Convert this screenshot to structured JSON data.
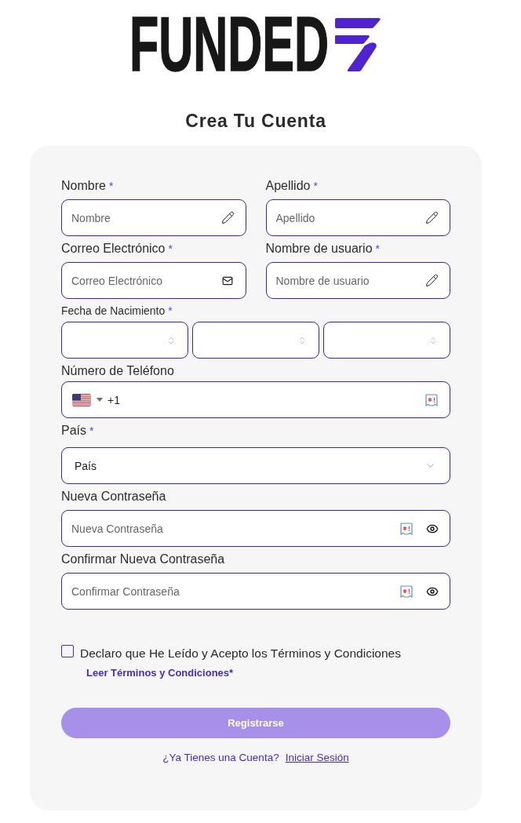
{
  "logo": {
    "wordmark": "FUNDED"
  },
  "title": "Crea Tu Cuenta",
  "form": {
    "rows": [
      {
        "fields": [
          {
            "kind": "text",
            "label": "Nombre",
            "required_mark": "*",
            "placeholder": "Nombre"
          },
          {
            "kind": "text",
            "label": "Apellido",
            "required_mark": "*",
            "placeholder": "Apellido"
          }
        ]
      },
      {
        "fields": [
          {
            "kind": "email",
            "label": "Correo Electrónico",
            "required_mark": "*",
            "placeholder": "Correo Electrónico"
          },
          {
            "kind": "text",
            "label": "Nombre de usuario",
            "required_mark": "*",
            "placeholder": "Nombre de usuario"
          }
        ]
      },
      {
        "fields": [
          {
            "kind": "date",
            "label": "Fecha de Nacimiento",
            "required_mark": "*",
            "selects": [
              {
                "kind": "select"
              },
              {
                "kind": "select"
              },
              {
                "kind": "select"
              }
            ]
          }
        ]
      },
      {
        "fields": [
          {
            "kind": "phone",
            "label": "Número de Teléfono",
            "dial_code": "+1"
          }
        ]
      },
      {
        "fields": [
          {
            "kind": "select",
            "label": "País",
            "required_mark": "*",
            "value": "País"
          }
        ]
      },
      {
        "fields": [
          {
            "kind": "password",
            "label": "Nueva Contraseña",
            "placeholder": "Nueva Contraseña"
          }
        ]
      },
      {
        "fields": [
          {
            "kind": "password",
            "label": "Confirmar Nueva Contraseña",
            "placeholder": "Confirmar Contraseña"
          }
        ]
      }
    ]
  },
  "terms": {
    "checked": false,
    "label": "Declaro que He Leído y Acepto los Términos y Condiciones",
    "link": "Leer Términos y Condiciones*"
  },
  "register_button": {
    "label": "Registrarse",
    "disabled": true
  },
  "footer": {
    "prompt": "¿Ya Tienes una Cuenta?",
    "link": "Iniciar Sesión"
  }
}
